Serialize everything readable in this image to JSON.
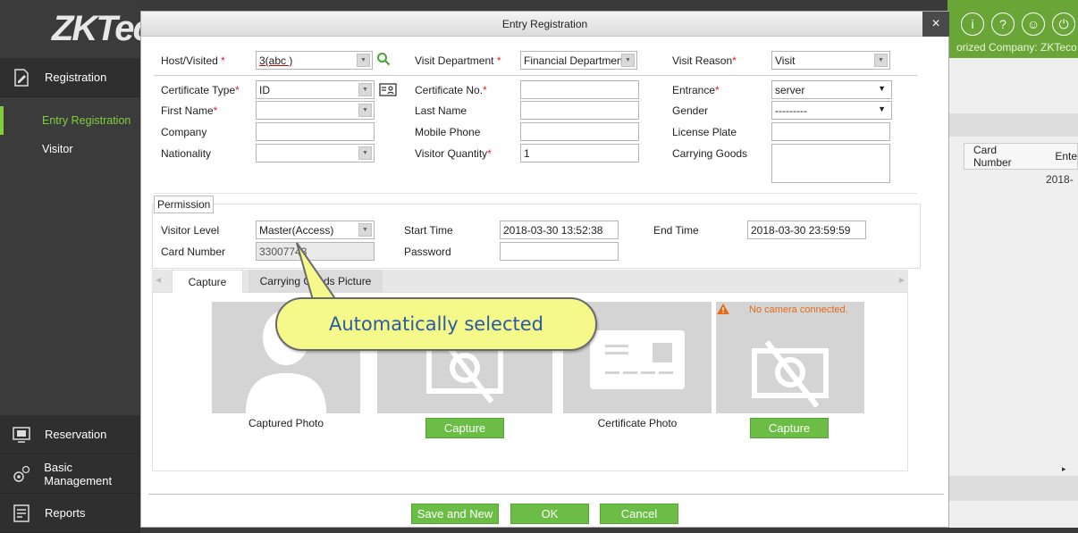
{
  "app": {
    "logo": "ZKTeco",
    "company": "orized Company: ZKTeco"
  },
  "sidebar": {
    "registration_label": "Registration",
    "items": [
      {
        "label": "Entry Registration"
      },
      {
        "label": "Visitor"
      }
    ],
    "reservation_label": "Reservation",
    "basic_management_label": "Basic Management",
    "reports_label": "Reports"
  },
  "background": {
    "col_card_number": "Card Number",
    "col_enter": "Ente",
    "cell_date": "2018-"
  },
  "dialog": {
    "title": "Entry Registration",
    "close": "×",
    "host_visited_label": "Host/Visited",
    "host_visited_value": "3(abc )",
    "visit_department_label": "Visit Department",
    "visit_department_value": "Financial Department",
    "visit_reason_label": "Visit Reason",
    "visit_reason_value": "Visit",
    "certificate_type_label": "Certificate Type",
    "certificate_type_value": "ID",
    "certificate_no_label": "Certificate No.",
    "certificate_no_value": "",
    "entrance_label": "Entrance",
    "entrance_value": "server",
    "first_name_label": "First Name",
    "first_name_value": "",
    "last_name_label": "Last Name",
    "last_name_value": "",
    "gender_label": "Gender",
    "gender_value": "---------",
    "company_label": "Company",
    "company_value": "",
    "mobile_phone_label": "Mobile Phone",
    "mobile_phone_value": "",
    "license_plate_label": "License Plate",
    "license_plate_value": "",
    "nationality_label": "Nationality",
    "nationality_value": "",
    "visitor_quantity_label": "Visitor Quantity",
    "visitor_quantity_value": "1",
    "carrying_goods_label": "Carrying Goods",
    "carrying_goods_value": "",
    "required_mark": "*",
    "permission": {
      "legend": "Permission",
      "visitor_level_label": "Visitor Level",
      "visitor_level_value": "Master(Access)",
      "start_time_label": "Start Time",
      "start_time_value": "2018-03-30 13:52:38",
      "end_time_label": "End Time",
      "end_time_value": "2018-03-30 23:59:59",
      "card_number_label": "Card Number",
      "card_number_value": "33007743",
      "password_label": "Password",
      "password_value": ""
    },
    "tabs": [
      {
        "label": "Capture"
      },
      {
        "label": "Carrying Goods Picture"
      }
    ],
    "capture": {
      "captured_photo_label": "Captured Photo",
      "capture_button_1": "Capture",
      "certificate_photo_label": "Certificate Photo",
      "capture_button_2": "Capture",
      "no_camera": "No camera connected."
    },
    "buttons": {
      "save_and_new": "Save and New",
      "ok": "OK",
      "cancel": "Cancel"
    }
  },
  "callout": {
    "text": "Automatically selected"
  },
  "colors": {
    "accent_green": "#6cbd45",
    "active_nav": "#7fcf3c",
    "required": "#e02020",
    "warning": "#e36b1a",
    "callout_bg": "#f5f98a",
    "callout_text": "#2a5aa5"
  }
}
